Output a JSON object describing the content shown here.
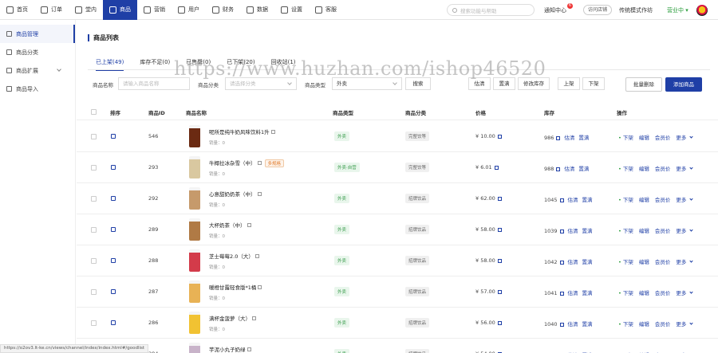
{
  "nav": {
    "items": [
      {
        "label": "首页",
        "icon": "home-icon"
      },
      {
        "label": "订单",
        "icon": "order-icon"
      },
      {
        "label": "堂内",
        "icon": "store-icon"
      },
      {
        "label": "商品",
        "icon": "goods-icon",
        "active": true
      },
      {
        "label": "营销",
        "icon": "marketing-icon"
      },
      {
        "label": "用户",
        "icon": "user-icon"
      },
      {
        "label": "财务",
        "icon": "finance-icon"
      },
      {
        "label": "数据",
        "icon": "data-icon"
      },
      {
        "label": "设置",
        "icon": "settings-icon"
      },
      {
        "label": "客服",
        "icon": "service-icon"
      }
    ],
    "search_placeholder": "搜索功能与帮助",
    "notify_label": "通知中心",
    "notify_count": "6",
    "visit_label": "访问店铺",
    "mode_label": "传统模式作坊",
    "status_label": "营业中 ",
    "accent_color": "#1f3fa6"
  },
  "sidebar": {
    "items": [
      {
        "label": "商品管理",
        "active": true
      },
      {
        "label": "商品分类"
      },
      {
        "label": "商品扩展",
        "expandable": true
      },
      {
        "label": "商品导入"
      }
    ]
  },
  "page": {
    "title": "商品列表",
    "tabs": [
      "已上架(49)",
      "库存不足(0)",
      "已售罄(0)",
      "已下架(20)",
      "回收站(1)"
    ]
  },
  "filters": {
    "name_label": "商品名称",
    "name_placeholder": "请输入商品名称",
    "category_label": "商品分类",
    "category_placeholder": "请选择分类",
    "type_label": "商品类型",
    "type_value": "外卖",
    "search_button": "搜索",
    "actions": [
      "估清",
      "置满",
      "修改库存",
      "上架",
      "下架"
    ],
    "batch_delete": "批量删除",
    "add_goods": "添加商品"
  },
  "table": {
    "headers": [
      "排序",
      "商品ID",
      "商品名称",
      "商品类型",
      "商品分类",
      "价格",
      "库存",
      "操作"
    ],
    "sales_prefix": "销量：",
    "ops": {
      "offshelf": "下架",
      "edit": "编辑",
      "member_price": "会员价",
      "more": "更多"
    },
    "stock_ops": [
      "估清",
      "置满"
    ],
    "rows": [
      {
        "id": "546",
        "name": "呢所是纯牛奶风味饮料1升",
        "tag": "",
        "sales": "0",
        "type": "外卖",
        "category": "完整饮等",
        "price": "¥ 10.00",
        "stock": "986",
        "thumb": "#6b2a12"
      },
      {
        "id": "293",
        "name": "牛椰拉冰杂雪（中）",
        "tag": "多规格",
        "sales": "0",
        "type": "外卖·自营",
        "category": "完整饮等",
        "price": "¥ 6.01",
        "stock": "988",
        "thumb": "#d9c8a0"
      },
      {
        "id": "292",
        "name": "心意甜奶奶茶（中）",
        "tag": "",
        "sales": "0",
        "type": "外卖",
        "category": "招牌饮品",
        "price": "¥ 62.00",
        "stock": "1045",
        "thumb": "#c69a6b"
      },
      {
        "id": "289",
        "name": "大杯奶茶（中）",
        "tag": "",
        "sales": "0",
        "type": "外卖",
        "category": "招牌饮品",
        "price": "¥ 58.00",
        "stock": "1039",
        "thumb": "#b07a45"
      },
      {
        "id": "288",
        "name": "芝士莓莓2.0（大）",
        "tag": "",
        "sales": "0",
        "type": "外卖",
        "category": "招牌饮品",
        "price": "¥ 58.00",
        "stock": "1042",
        "thumb": "#d33b4a"
      },
      {
        "id": "287",
        "name": "暖橙甘露轻食版*1桶",
        "tag": "",
        "sales": "0",
        "type": "外卖",
        "category": "招牌饮品",
        "price": "¥ 57.00",
        "stock": "1041",
        "thumb": "#e8b255"
      },
      {
        "id": "286",
        "name": "满杯金菠萝（大）",
        "tag": "",
        "sales": "0",
        "type": "外卖",
        "category": "招牌饮品",
        "price": "¥ 56.00",
        "stock": "1040",
        "thumb": "#f1c232"
      },
      {
        "id": "284",
        "name": "芋泥小丸子奶绿",
        "tag": "",
        "sales": "0",
        "type": "外卖",
        "category": "招牌饮品",
        "price": "¥ 54.00",
        "stock": "1038",
        "thumb": "#c8b3c9"
      }
    ]
  },
  "status_url": "https://o2ov3.lt-ke.cn/views/channel/index/index.html#/goodlist",
  "watermark": "https://www.huzhan.com/ishop46520"
}
